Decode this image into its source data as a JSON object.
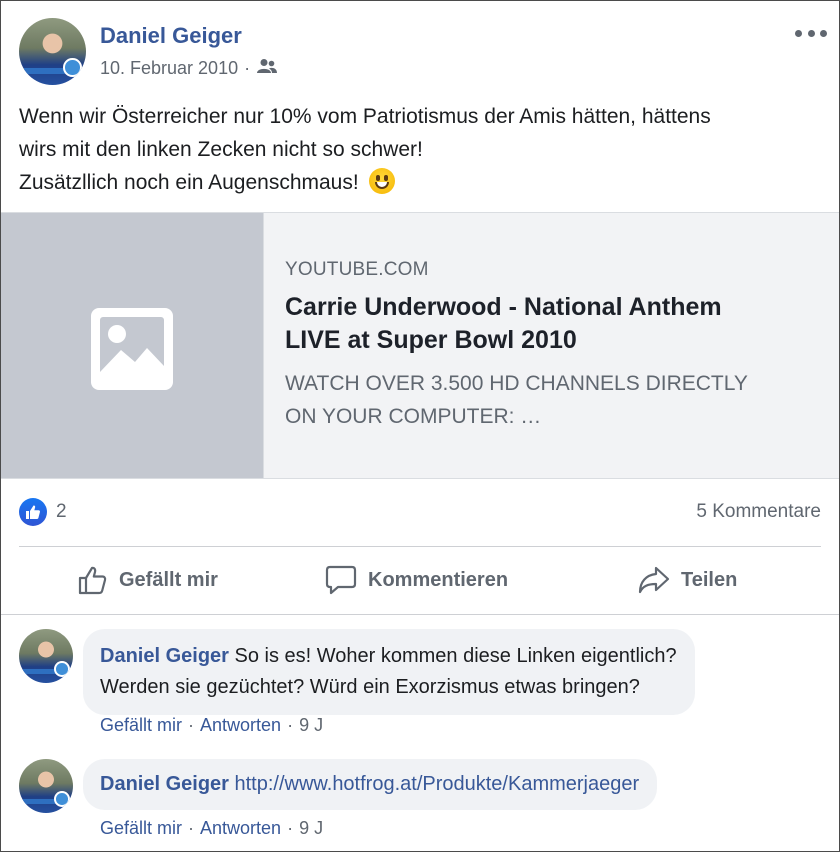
{
  "post": {
    "author": "Daniel Geiger",
    "date": "10. Februar 2010",
    "audience_icon": "friends-icon",
    "text_lines": [
      "Wenn wir Österreicher nur 10% vom Patriotismus der Amis hätten, hättens",
      "wirs mit den linken Zecken nicht so schwer!",
      "Zusätzllich noch ein Augenschmaus!"
    ],
    "emoji": "grinning-face-emoji"
  },
  "link_card": {
    "domain": "YOUTUBE.COM",
    "title_lines": [
      "Carrie Underwood - National Anthem",
      "LIVE at Super Bowl 2010"
    ],
    "description_lines": [
      "WATCH OVER 3.500 HD CHANNELS DIRECTLY",
      "ON YOUR COMPUTER: …"
    ]
  },
  "stats": {
    "likes": "2",
    "comments": "5 Kommentare"
  },
  "actions": {
    "like": "Gefällt mir",
    "comment": "Kommentieren",
    "share": "Teilen"
  },
  "comments": [
    {
      "author": "Daniel Geiger",
      "lines": [
        "So is es! Woher kommen diese Linken eigentlich?",
        "Werden sie gezüchtet? Würd ein Exorzismus etwas bringen?"
      ],
      "like": "Gefällt mir",
      "reply": "Antworten",
      "time": "9 J"
    },
    {
      "author": "Daniel Geiger",
      "link": "http://www.hotfrog.at/Produkte/Kammerjaeger",
      "like": "Gefällt mir",
      "reply": "Antworten",
      "time": "9 J"
    }
  ],
  "colors": {
    "name_blue": "#385898",
    "meta_gray": "#606770",
    "like_blue": "#1877f2",
    "card_bg": "#f2f3f5",
    "placeholder_gray": "#c4c8d0"
  }
}
